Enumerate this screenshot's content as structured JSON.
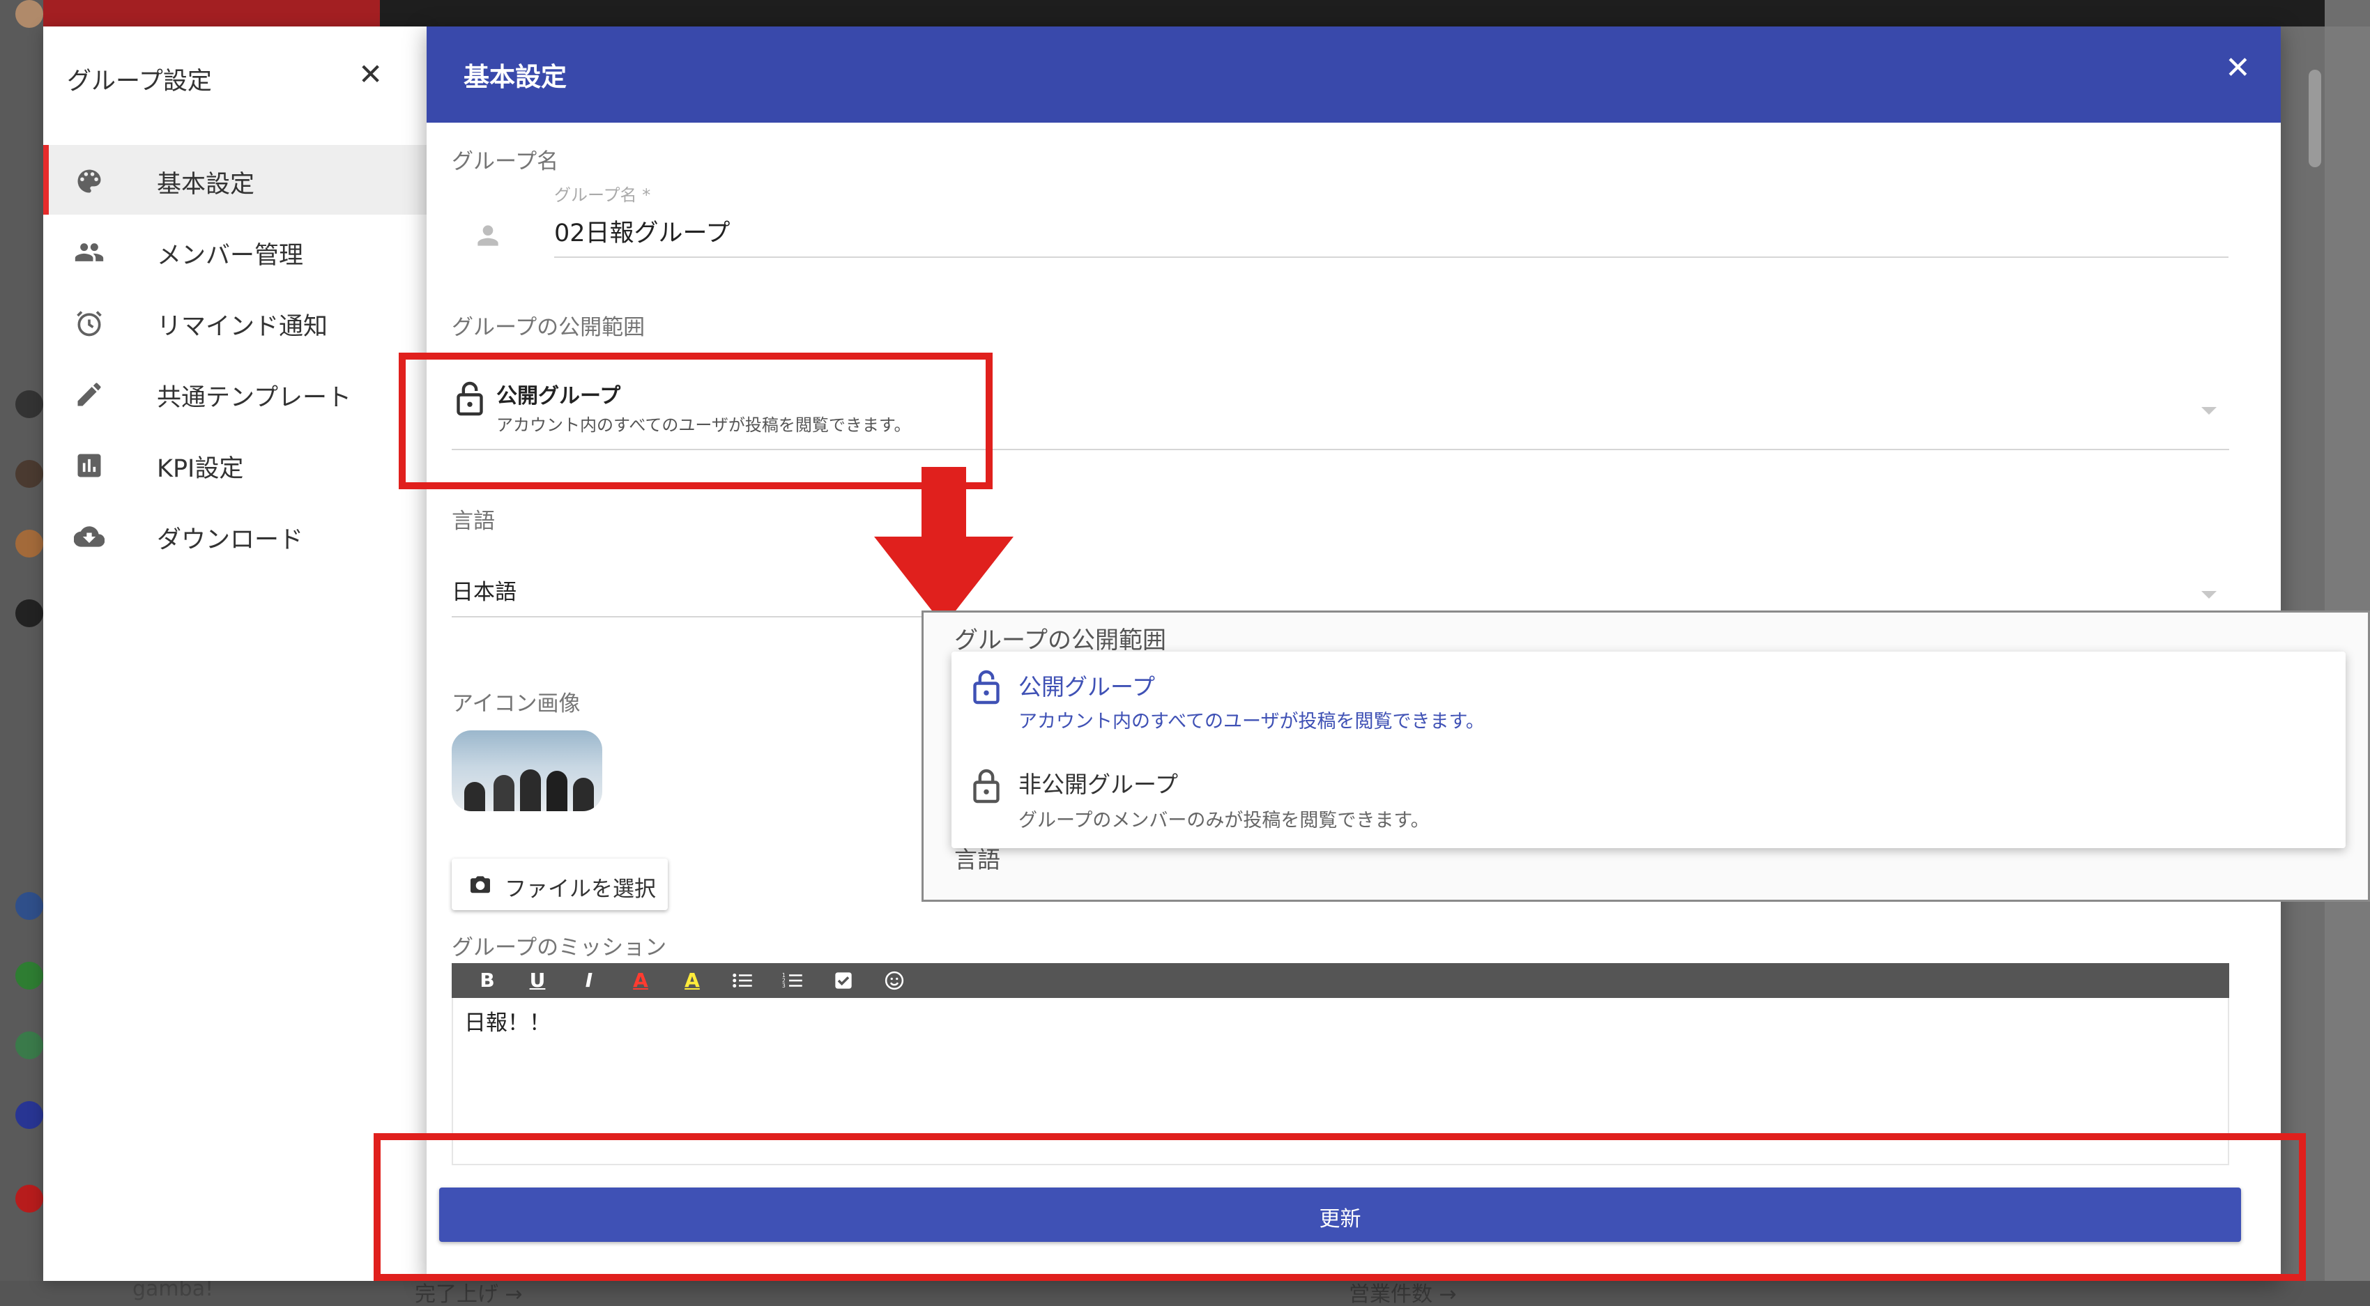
{
  "background": {
    "bottom_left_text": "gamba!",
    "bottom_mid_text": "完了上げ →",
    "bottom_right_text": "営業件数 →"
  },
  "sidebar": {
    "title": "グループ設定",
    "close_glyph": "✕",
    "items": [
      {
        "label": "基本設定",
        "icon": "palette-icon",
        "active": true
      },
      {
        "label": "メンバー管理",
        "icon": "people-icon",
        "active": false
      },
      {
        "label": "リマインド通知",
        "icon": "alarm-icon",
        "active": false
      },
      {
        "label": "共通テンプレート",
        "icon": "pencil-icon",
        "active": false
      },
      {
        "label": "KPI設定",
        "icon": "bar-chart-icon",
        "active": false
      },
      {
        "label": "ダウンロード",
        "icon": "cloud-download-icon",
        "active": false
      }
    ]
  },
  "dialog": {
    "title": "基本設定",
    "close_glyph": "✕",
    "group_name": {
      "section_label": "グループ名",
      "float_label": "グループ名 *",
      "value": "02日報グループ"
    },
    "visibility": {
      "section_label": "グループの公開範囲",
      "selected_title": "公開グループ",
      "selected_desc": "アカウント内のすべてのユーザが投稿を閲覧できます。"
    },
    "language": {
      "section_label": "言語",
      "value": "日本語"
    },
    "icon_image": {
      "section_label": "アイコン画像",
      "file_button": "ファイルを選択"
    },
    "mission": {
      "section_label": "グループのミッション",
      "toolbar": [
        "B",
        "U",
        "I",
        "A",
        "A",
        "list-bullet-icon",
        "list-number-icon",
        "checkbox-icon",
        "emoji-icon"
      ],
      "content": "日報！！"
    },
    "update_button": "更新"
  },
  "popup": {
    "label": "グループの公開範囲",
    "under_label": "言語",
    "options": [
      {
        "title": "公開グループ",
        "desc": "アカウント内のすべてのユーザが投稿を閲覧できます。",
        "selected": true
      },
      {
        "title": "非公開グループ",
        "desc": "グループのメンバーのみが投稿を閲覧できます。",
        "selected": false
      }
    ]
  },
  "colors": {
    "header": "#3949ab",
    "button": "#3f51b5",
    "annotation": "#e0201d",
    "selected_option": "#3f51b5"
  }
}
